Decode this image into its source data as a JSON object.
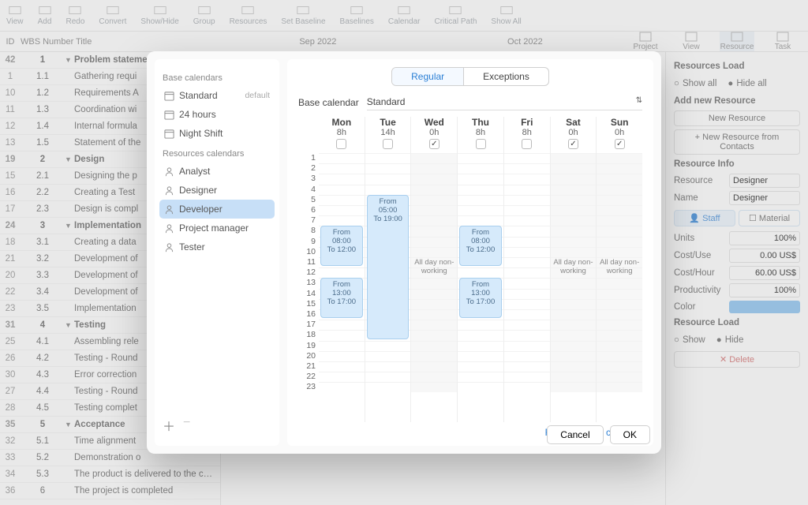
{
  "toolbar": [
    "View",
    "Add",
    "Redo",
    "Convert",
    "Show/Hide",
    "Group",
    "Resources",
    "Set Baseline",
    "Baselines",
    "Calendar",
    "Critical Path",
    "Show All"
  ],
  "columns": {
    "id": "ID",
    "wbs": "WBS Number",
    "title": "Title"
  },
  "months": [
    "Sep 2022",
    "Oct 2022"
  ],
  "right_toolbar": [
    "Project",
    "View",
    "Resource",
    "Task"
  ],
  "tasks": [
    {
      "id": "42",
      "wbs": "1",
      "title": "Problem statement",
      "group": true,
      "extra": "1"
    },
    {
      "id": "1",
      "wbs": "1.1",
      "title": "Gathering requi"
    },
    {
      "id": "10",
      "wbs": "1.2",
      "title": "Requirements A"
    },
    {
      "id": "11",
      "wbs": "1.3",
      "title": "Coordination wi"
    },
    {
      "id": "12",
      "wbs": "1.4",
      "title": "Internal formula"
    },
    {
      "id": "13",
      "wbs": "1.5",
      "title": "Statement of the"
    },
    {
      "id": "19",
      "wbs": "2",
      "title": "Design",
      "group": true
    },
    {
      "id": "15",
      "wbs": "2.1",
      "title": "Designing the p"
    },
    {
      "id": "16",
      "wbs": "2.2",
      "title": "Creating a Test"
    },
    {
      "id": "17",
      "wbs": "2.3",
      "title": "Design is compl"
    },
    {
      "id": "24",
      "wbs": "3",
      "title": "Implementation",
      "group": true
    },
    {
      "id": "18",
      "wbs": "3.1",
      "title": "Creating a data"
    },
    {
      "id": "21",
      "wbs": "3.2",
      "title": "Development of"
    },
    {
      "id": "20",
      "wbs": "3.3",
      "title": "Development of"
    },
    {
      "id": "22",
      "wbs": "3.4",
      "title": "Development of"
    },
    {
      "id": "23",
      "wbs": "3.5",
      "title": "Implementation"
    },
    {
      "id": "31",
      "wbs": "4",
      "title": "Testing",
      "group": true
    },
    {
      "id": "25",
      "wbs": "4.1",
      "title": "Assembling rele"
    },
    {
      "id": "26",
      "wbs": "4.2",
      "title": "Testing - Round"
    },
    {
      "id": "30",
      "wbs": "4.3",
      "title": "Error correction"
    },
    {
      "id": "27",
      "wbs": "4.4",
      "title": "Testing - Round"
    },
    {
      "id": "28",
      "wbs": "4.5",
      "title": "Testing complet"
    },
    {
      "id": "35",
      "wbs": "5",
      "title": "Acceptance",
      "group": true
    },
    {
      "id": "32",
      "wbs": "5.1",
      "title": "Time alignment"
    },
    {
      "id": "33",
      "wbs": "5.2",
      "title": "Demonstration o"
    },
    {
      "id": "34",
      "wbs": "5.3",
      "title": "The product is delivered to the cu…",
      "extra": "5.3"
    },
    {
      "id": "36",
      "wbs": "6",
      "title": "The project is completed",
      "extra": "6"
    }
  ],
  "right_panel": {
    "sec1": "Resources Load",
    "radio_showall": "Show all",
    "radio_hideall": "Hide all",
    "sec2": "Add new Resource",
    "btn_newres": "New Resource",
    "btn_newcontact": "+ New Resource from Contacts",
    "sec3": "Resource Info",
    "lbl_res": "Resource",
    "val_res": "Designer",
    "lbl_name": "Name",
    "val_name": "Designer",
    "tab_staff": "Staff",
    "tab_material": "Material",
    "lbl_units": "Units",
    "val_units": "100%",
    "lbl_costuse": "Cost/Use",
    "val_costuse": "0.00 US$",
    "lbl_costhr": "Cost/Hour",
    "val_costhr": "60.00 US$",
    "lbl_prod": "Productivity",
    "val_prod": "100%",
    "lbl_color": "Color",
    "sec4": "Resource Load",
    "radio_show": "Show",
    "radio_hide": "Hide",
    "btn_delete": "Delete"
  },
  "modal": {
    "sidebar": {
      "base_label": "Base calendars",
      "base": [
        {
          "name": "Standard",
          "default": true
        },
        {
          "name": "24 hours"
        },
        {
          "name": "Night Shift"
        }
      ],
      "res_label": "Resources calendars",
      "res": [
        {
          "name": "Analyst"
        },
        {
          "name": "Designer"
        },
        {
          "name": "Developer",
          "selected": true
        },
        {
          "name": "Project manager"
        },
        {
          "name": "Tester"
        }
      ],
      "default_text": "default"
    },
    "seg_regular": "Regular",
    "seg_exceptions": "Exceptions",
    "basecal_label": "Base calendar",
    "basecal_value": "Standard",
    "days": [
      {
        "name": "Mon",
        "hours": "8h",
        "checked": false,
        "blocks": [
          {
            "from": "From 08:00",
            "to": "To 12:00",
            "start": 8,
            "end": 12
          },
          {
            "from": "From 13:00",
            "to": "To 17:00",
            "start": 13,
            "end": 17
          }
        ]
      },
      {
        "name": "Tue",
        "hours": "14h",
        "checked": false,
        "blocks": [
          {
            "from": "From 05:00",
            "to": "To 19:00",
            "start": 5,
            "end": 19
          }
        ]
      },
      {
        "name": "Wed",
        "hours": "0h",
        "checked": true,
        "allday": "All day non-working"
      },
      {
        "name": "Thu",
        "hours": "8h",
        "checked": false,
        "blocks": [
          {
            "from": "From 08:00",
            "to": "To 12:00",
            "start": 8,
            "end": 12
          },
          {
            "from": "From 13:00",
            "to": "To 17:00",
            "start": 13,
            "end": 17
          }
        ]
      },
      {
        "name": "Fri",
        "hours": "8h",
        "checked": false,
        "blocks": []
      },
      {
        "name": "Sat",
        "hours": "0h",
        "checked": true,
        "allday": "All day non-working"
      },
      {
        "name": "Sun",
        "hours": "0h",
        "checked": true,
        "allday": "All day non-working"
      }
    ],
    "reset": "Reset to base calendar",
    "cancel": "Cancel",
    "ok": "OK"
  }
}
